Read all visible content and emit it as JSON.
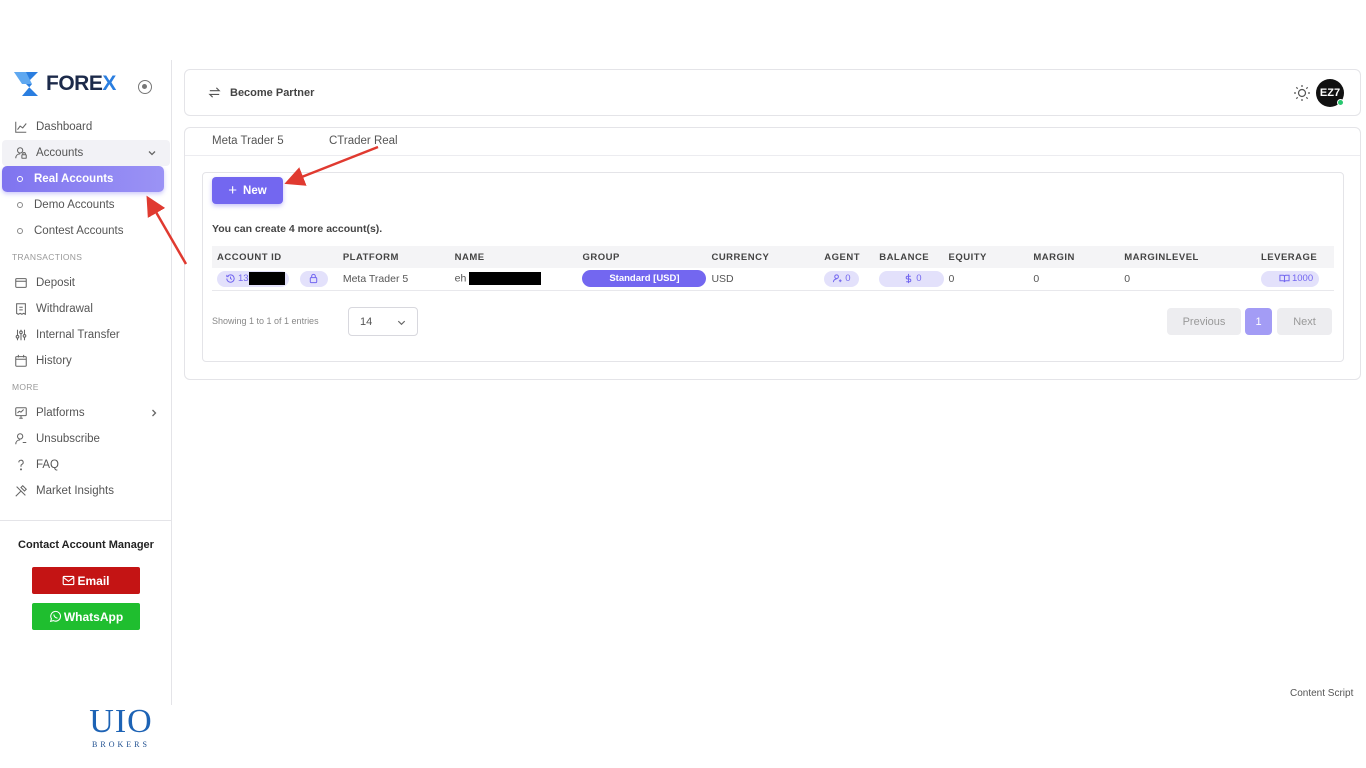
{
  "brand": {
    "logo_text_main": "FORE",
    "logo_text_x": "X"
  },
  "sidebar": {
    "items": [
      {
        "label": "Dashboard",
        "icon": "chart-icon"
      },
      {
        "label": "Accounts",
        "icon": "user-lock-icon"
      }
    ],
    "accounts_sub": [
      {
        "label": "Real Accounts",
        "active": true
      },
      {
        "label": "Demo Accounts"
      },
      {
        "label": "Contest Accounts"
      }
    ],
    "section_transactions": "TRANSACTIONS",
    "transactions": [
      {
        "label": "Deposit",
        "icon": "wallet-icon"
      },
      {
        "label": "Withdrawal",
        "icon": "receipt-icon"
      },
      {
        "label": "Internal Transfer",
        "icon": "sliders-icon"
      },
      {
        "label": "History",
        "icon": "calendar-icon"
      }
    ],
    "section_more": "MORE",
    "more": [
      {
        "label": "Platforms",
        "icon": "monitor-icon"
      },
      {
        "label": "Unsubscribe",
        "icon": "user-icon"
      },
      {
        "label": "FAQ",
        "icon": "question-icon"
      },
      {
        "label": "Market Insights",
        "icon": "tools-icon"
      }
    ],
    "contact": {
      "title": "Contact Account Manager",
      "email_label": "Email",
      "whatsapp_label": "WhatsApp"
    }
  },
  "header": {
    "become_partner": "Become Partner",
    "avatar_text": "EZ7"
  },
  "tabs": [
    "Meta Trader 5",
    "CTrader Real"
  ],
  "main": {
    "new_button": "New",
    "create_note": "You can create 4 more account(s).",
    "table": {
      "headers": [
        "ACCOUNT ID",
        "PLATFORM",
        "NAME",
        "GROUP",
        "CURRENCY",
        "AGENT",
        "BALANCE",
        "EQUITY",
        "MARGIN",
        "MARGINLEVEL",
        "LEVERAGE"
      ],
      "rows": [
        {
          "account_id_prefix": "13",
          "platform": "Meta Trader 5",
          "name_prefix": "eh",
          "group": "Standard [USD]",
          "currency": "USD",
          "agent": "0",
          "balance": "0",
          "equity": "0",
          "margin": "0",
          "marginlevel": "0",
          "leverage": "1000"
        }
      ]
    },
    "entries_info": "Showing 1 to 1 of 1 entries",
    "page_size": "14",
    "pagination": {
      "previous": "Previous",
      "current": "1",
      "next": "Next"
    }
  },
  "footer_note": "Content Script",
  "uio_logo": {
    "mark": "UIO",
    "sub": "BROKERS"
  },
  "colors": {
    "accent": "#7367f0",
    "email": "#c41414",
    "whatsapp": "#1fbe2f",
    "annotation": "#e03a30"
  }
}
